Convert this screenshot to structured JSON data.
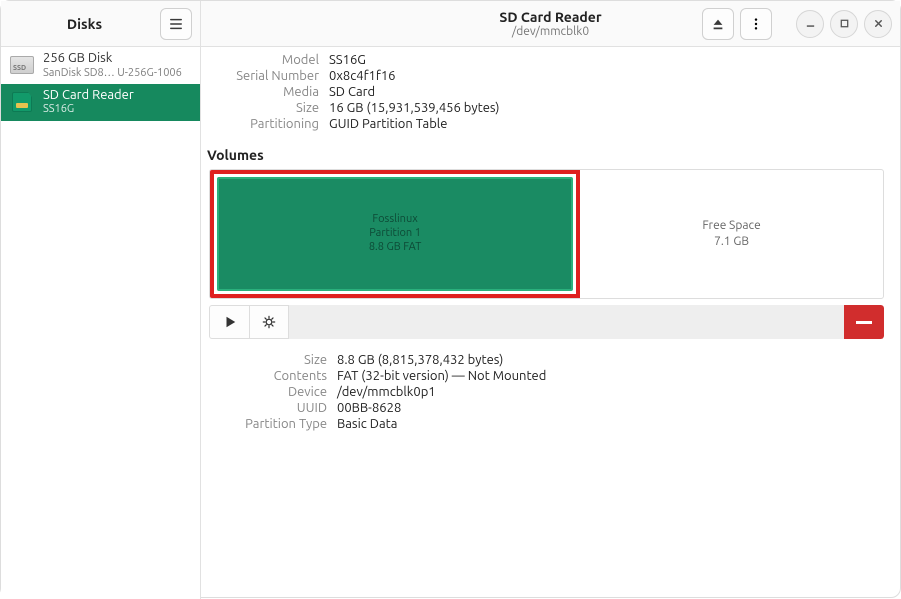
{
  "header": {
    "left_title": "Disks",
    "right_title": "SD Card Reader",
    "right_subtitle": "/dev/mmcblk0"
  },
  "sidebar": {
    "devices": [
      {
        "name": "256 GB Disk",
        "sub": "SanDisk SD8…  U-256G-1006",
        "icon": "ssd"
      },
      {
        "name": "SD Card Reader",
        "sub": "SS16G",
        "icon": "sd",
        "selected": true
      }
    ]
  },
  "drive": {
    "model_label": "Model",
    "model": "SS16G",
    "serial_label": "Serial Number",
    "serial": "0x8c4f1f16",
    "media_label": "Media",
    "media": "SD Card",
    "size_label": "Size",
    "size": "16 GB (15,931,539,456 bytes)",
    "part_label": "Partitioning",
    "partitioning": "GUID Partition Table"
  },
  "volumes": {
    "heading": "Volumes",
    "selected": {
      "name": "Fosslinux",
      "subtitle": "Partition 1",
      "detail": "8.8 GB FAT"
    },
    "free": {
      "name": "Free Space",
      "size": "7.1 GB"
    }
  },
  "partition": {
    "size_label": "Size",
    "size": "8.8 GB (8,815,378,432 bytes)",
    "contents_label": "Contents",
    "contents": "FAT (32-bit version) — Not Mounted",
    "device_label": "Device",
    "device": "/dev/mmcblk0p1",
    "uuid_label": "UUID",
    "uuid": "00BB-8628",
    "ptype_label": "Partition Type",
    "ptype": "Basic Data"
  }
}
